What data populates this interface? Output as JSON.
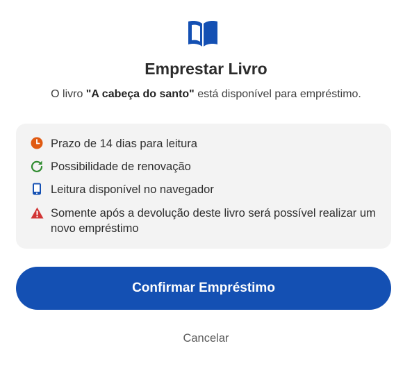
{
  "dialog": {
    "title": "Emprestar Livro",
    "subtitle": {
      "prefix": "O livro ",
      "book_title": "\"A cabeça do santo\"",
      "suffix": " está disponível para empréstimo."
    },
    "info_items": [
      {
        "icon": "clock-icon",
        "color": "#e05a12",
        "text": "Prazo de 14 dias para leitura"
      },
      {
        "icon": "renew-icon",
        "color": "#2e8b2e",
        "text": "Possibilidade de renovação"
      },
      {
        "icon": "phone-icon",
        "color": "#1450b3",
        "text": "Leitura disponível no navegador"
      },
      {
        "icon": "warning-icon",
        "color": "#d13434",
        "text": "Somente após a devolução deste livro será possível realizar um novo empréstimo"
      }
    ],
    "confirm_label": "Confirmar Empréstimo",
    "cancel_label": "Cancelar"
  },
  "colors": {
    "accent": "#1450b3",
    "info_background": "#f3f3f3"
  }
}
